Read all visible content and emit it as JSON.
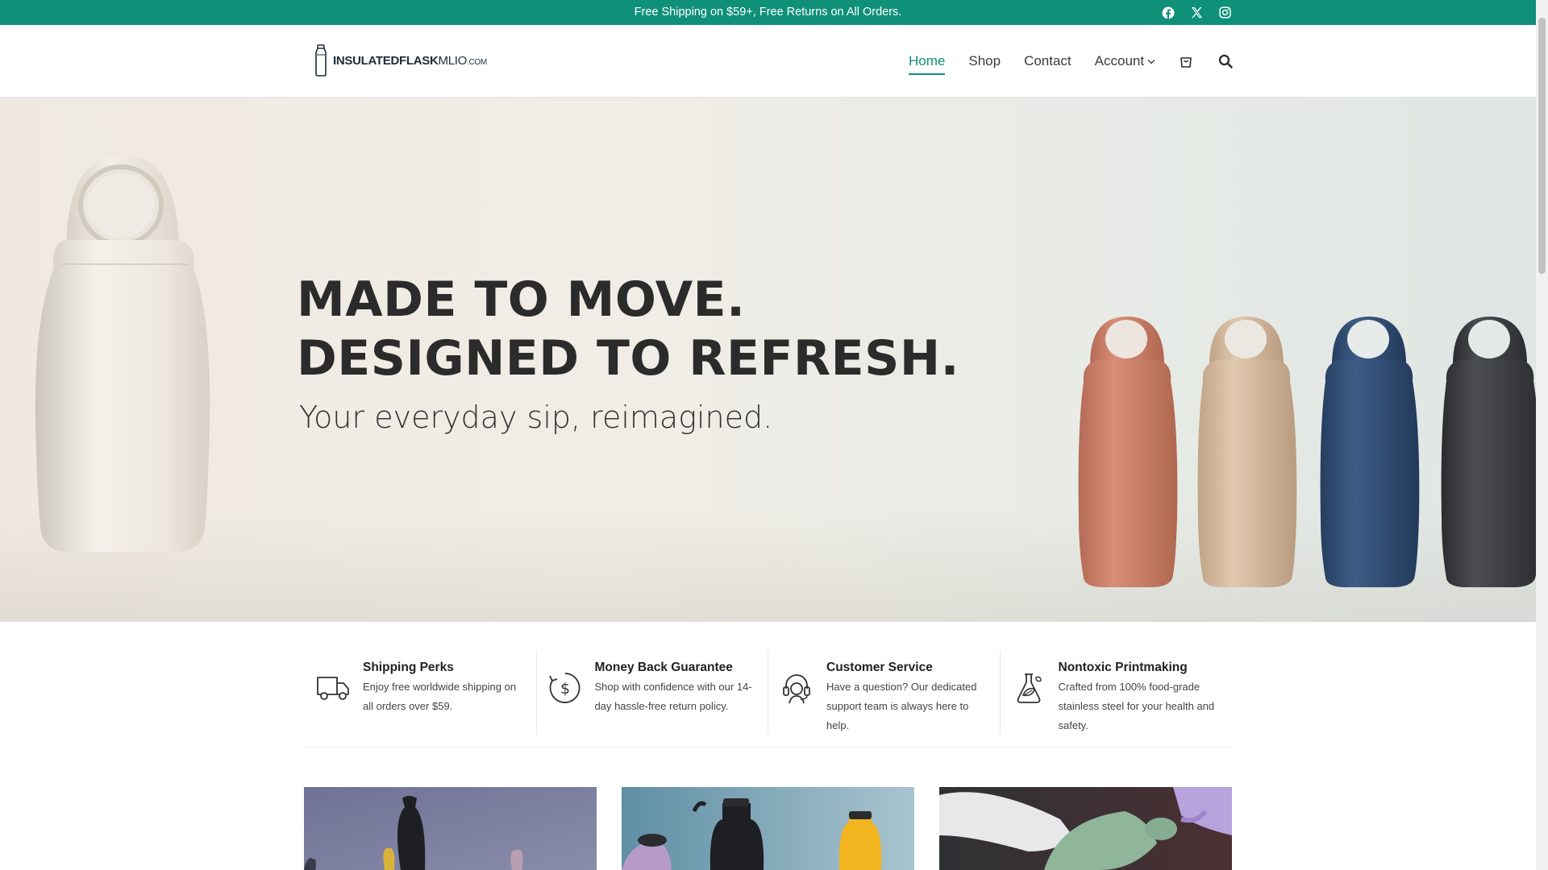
{
  "topbar": {
    "message": "Free Shipping on $59+, Free Returns on All Orders.",
    "socials": [
      "facebook-icon",
      "x-icon",
      "instagram-icon"
    ]
  },
  "logo": {
    "bold": "INSULATEDFLASK",
    "light": "MLIO",
    "suffix": ".COM"
  },
  "nav": {
    "items": [
      {
        "label": "Home",
        "active": true
      },
      {
        "label": "Shop"
      },
      {
        "label": "Contact"
      },
      {
        "label": "Account"
      }
    ]
  },
  "hero": {
    "line1": "MADE TO MOVE.",
    "line2": "DESIGNED TO REFRESH.",
    "tagline": "Your everyday sip, reimagined."
  },
  "features": [
    {
      "icon": "truck-icon",
      "title": "Shipping Perks",
      "desc": "Enjoy free worldwide shipping on all orders over $59."
    },
    {
      "icon": "money-back-icon",
      "title": "Money Back Guarantee",
      "desc": "Shop with confidence with our 14-day hassle-free return policy."
    },
    {
      "icon": "headset-icon",
      "title": "Customer Service",
      "desc": "Have a question? Our dedicated support team is always here to help."
    },
    {
      "icon": "flask-leaf-icon",
      "title": "Nontoxic Printmaking",
      "desc": "Crafted from 100% food-grade stainless steel for your health and safety."
    }
  ],
  "colors": {
    "accent": "#0f9079",
    "text": "#2b2b2b"
  }
}
